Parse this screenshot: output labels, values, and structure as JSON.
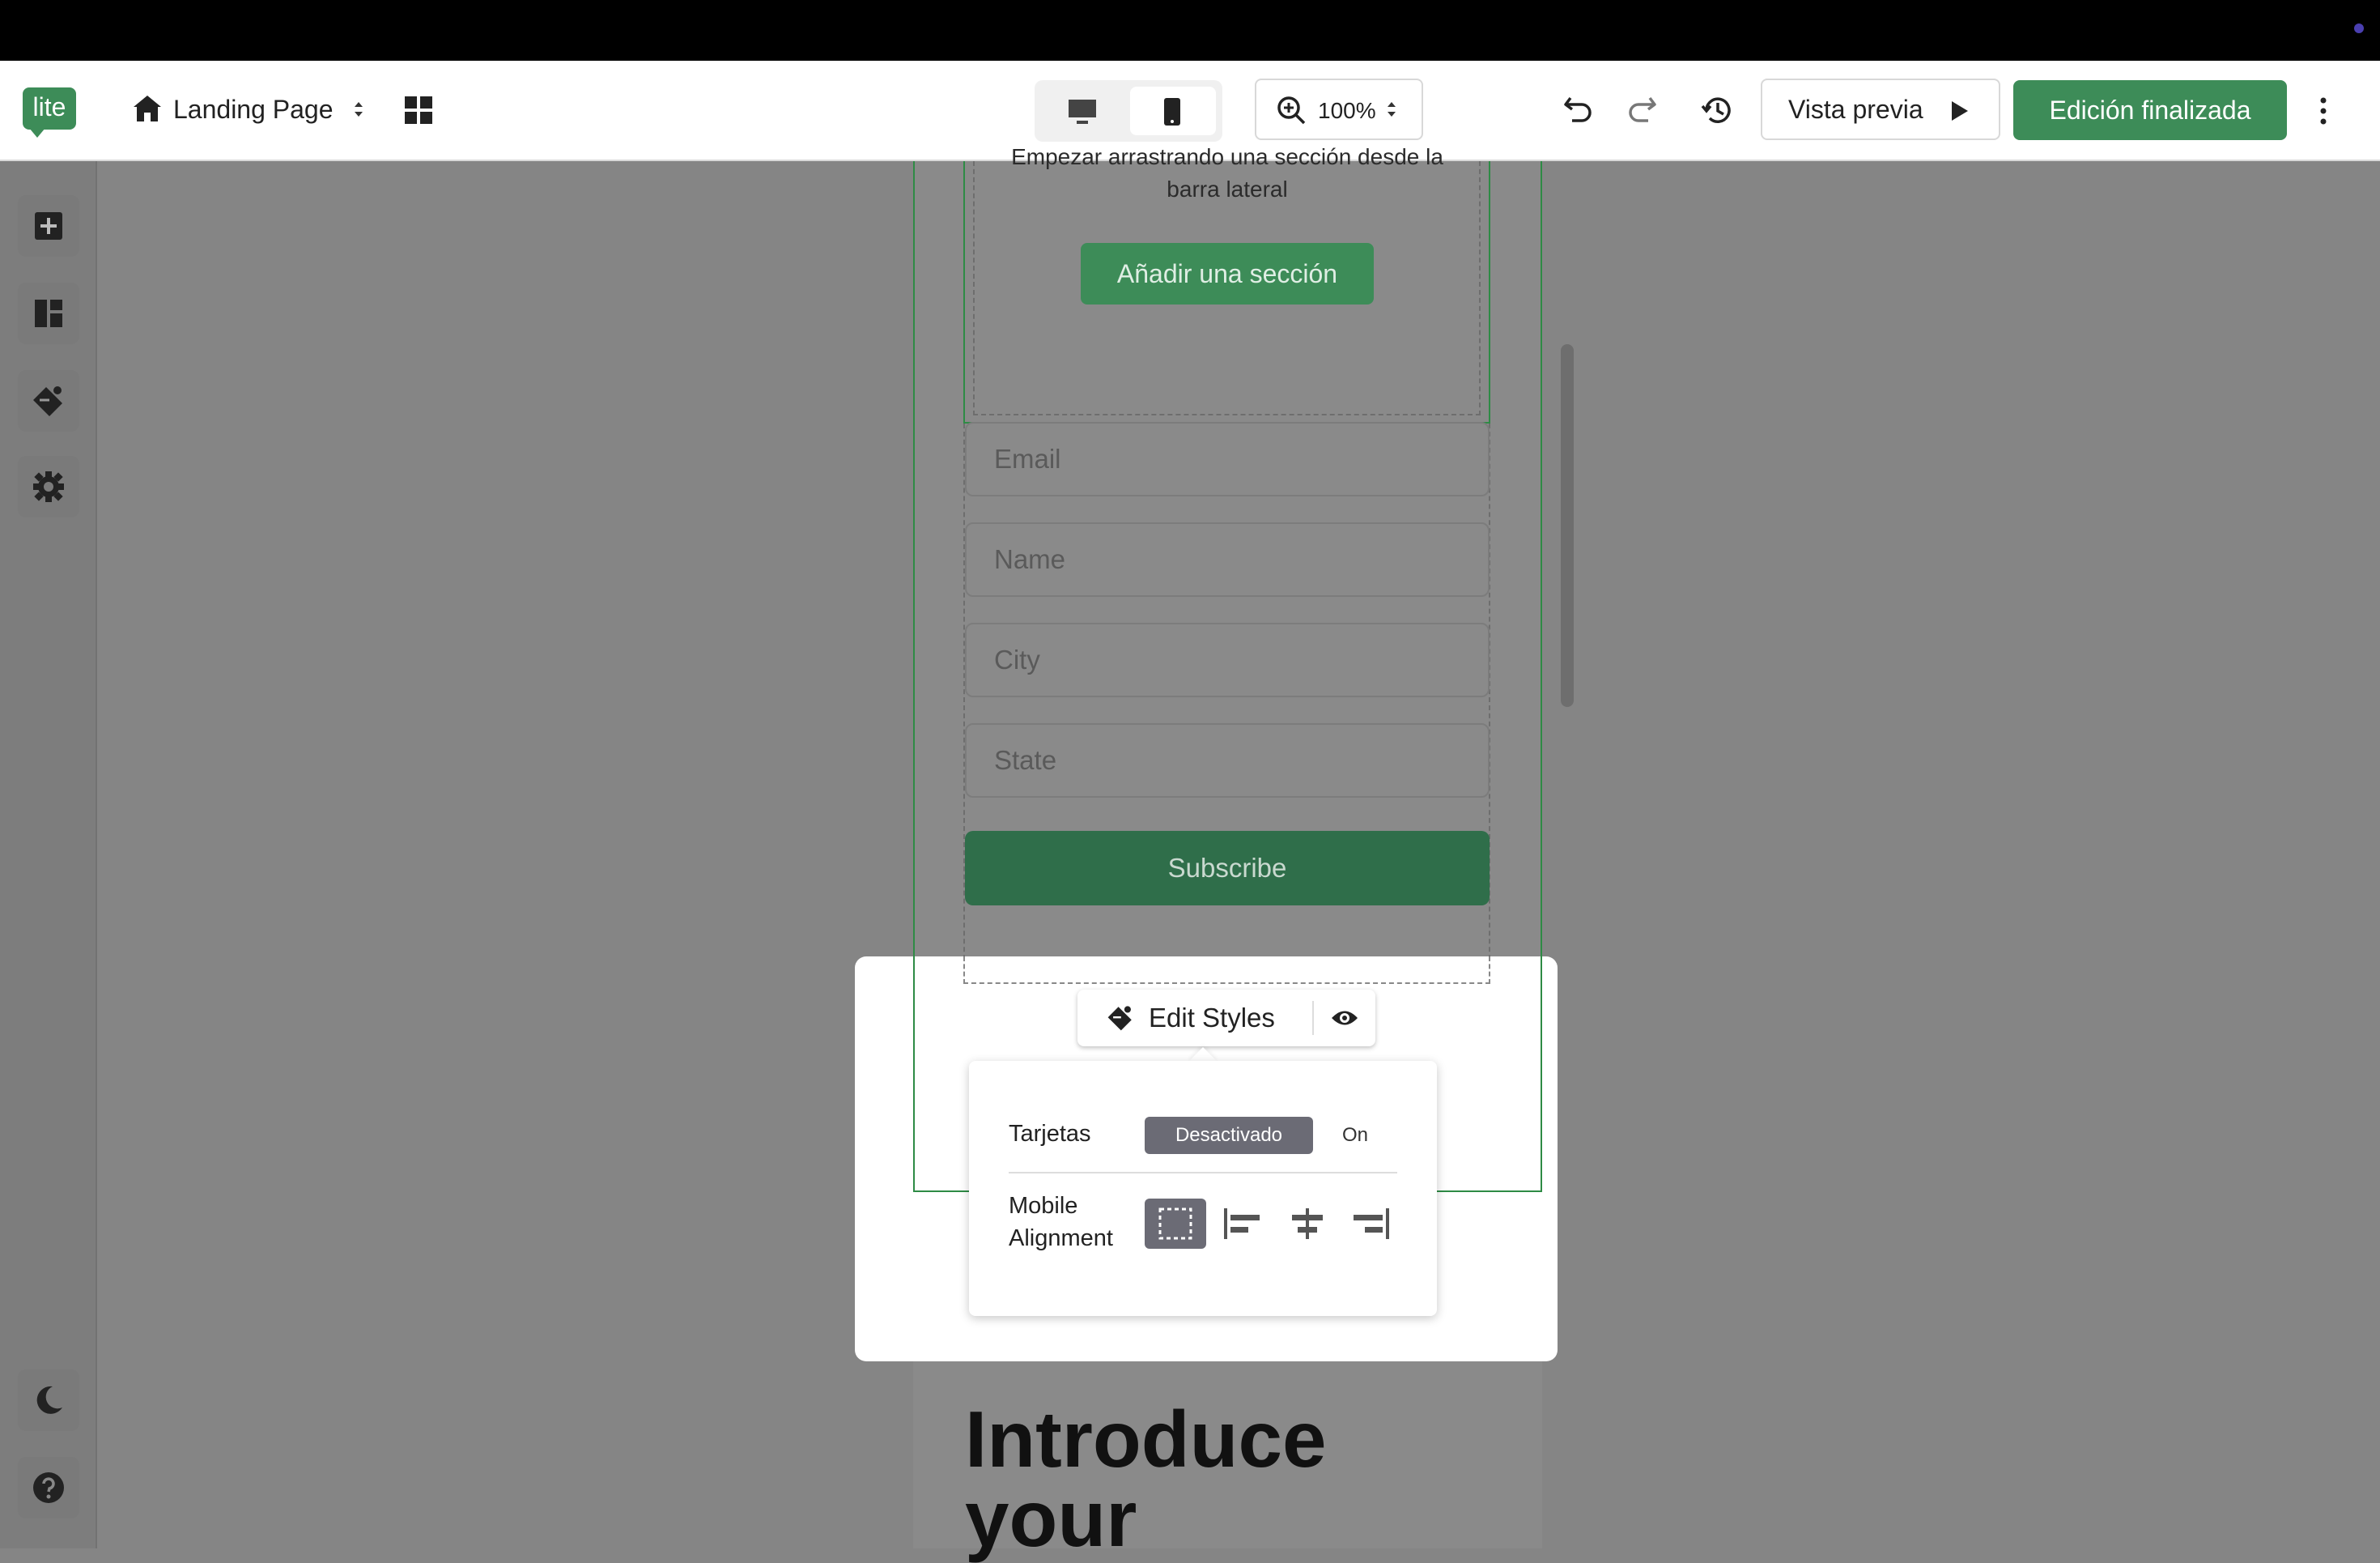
{
  "toolbar": {
    "logo": "lite",
    "page_name": "Landing Page",
    "zoom": "100%",
    "preview_label": "Vista previa",
    "finish_label": "Edición finalizada"
  },
  "canvas": {
    "top_text": "Empezar arrastrando una sección desde la barra lateral",
    "add_section_label": "Añadir una sección",
    "fields": [
      {
        "placeholder": "Email"
      },
      {
        "placeholder": "Name"
      },
      {
        "placeholder": "City"
      },
      {
        "placeholder": "State"
      }
    ],
    "subscribe_label": "Subscribe",
    "heading_line1": "Introduce",
    "heading_line2": "your"
  },
  "popover": {
    "edit_styles_label": "Edit Styles",
    "cards_label": "Tarjetas",
    "cards_off": "Desactivado",
    "cards_on": "On",
    "mobile_label_line1": "Mobile",
    "mobile_label_line2": "Alignment"
  },
  "colors": {
    "accent": "#3d8c58",
    "selection": "#2e8b45"
  }
}
